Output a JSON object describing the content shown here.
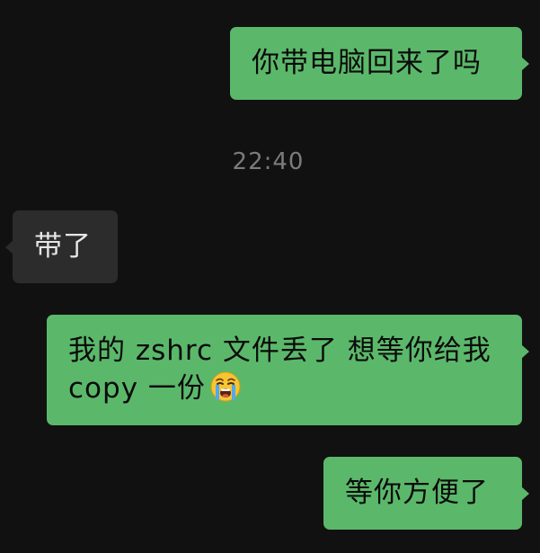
{
  "messages": [
    {
      "direction": "outgoing",
      "text": "你带电脑回来了吗"
    },
    {
      "direction": "incoming",
      "text": "带了"
    },
    {
      "direction": "outgoing",
      "line1": "我的 zshrc 文件丢了 想等你给我",
      "line2": "copy 一份",
      "emoji": "loudly-crying-face-emoji"
    },
    {
      "direction": "outgoing",
      "text": "等你方便了"
    }
  ],
  "timestamp": "22:40",
  "colors": {
    "background": "#111111",
    "outgoing_bubble": "#5bb86a",
    "incoming_bubble": "#2c2c2c",
    "timestamp_text": "#7b7b7b"
  }
}
